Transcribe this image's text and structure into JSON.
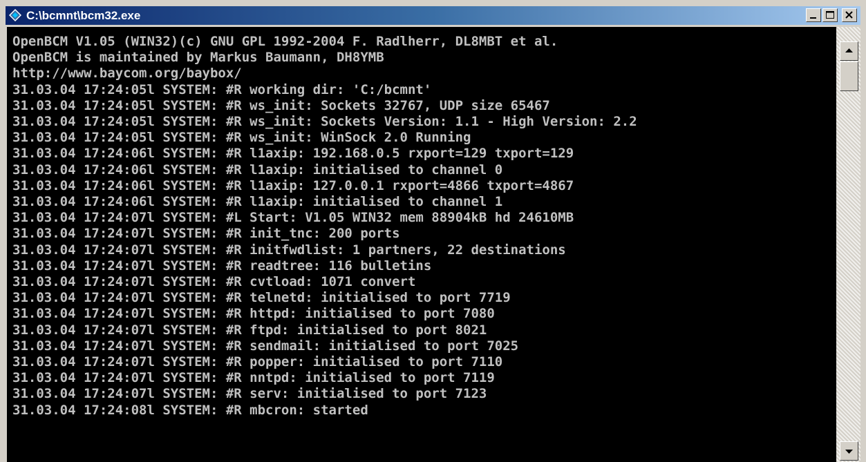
{
  "window": {
    "title": "C:\\bcmnt\\bcm32.exe",
    "titlebar_color": "#0a246a",
    "console_bg": "#000000",
    "console_fg": "#c0c0c0",
    "controls": [
      "minimize-icon",
      "maximize-icon",
      "close-icon"
    ],
    "app_icon": "console-app-icon"
  },
  "console": {
    "lines": [
      "OpenBCM V1.05 (WIN32)(c) GNU GPL 1992-2004 F. Radlherr, DL8MBT et al.",
      "OpenBCM is maintained by Markus Baumann, DH8YMB",
      "http://www.baycom.org/baybox/",
      "31.03.04 17:24:05l SYSTEM: #R working dir: 'C:/bcmnt'",
      "31.03.04 17:24:05l SYSTEM: #R ws_init: Sockets 32767, UDP size 65467",
      "31.03.04 17:24:05l SYSTEM: #R ws_init: Sockets Version: 1.1 - High Version: 2.2",
      "31.03.04 17:24:05l SYSTEM: #R ws_init: WinSock 2.0 Running",
      "31.03.04 17:24:06l SYSTEM: #R l1axip: 192.168.0.5 rxport=129 txport=129",
      "31.03.04 17:24:06l SYSTEM: #R l1axip: initialised to channel 0",
      "31.03.04 17:24:06l SYSTEM: #R l1axip: 127.0.0.1 rxport=4866 txport=4867",
      "31.03.04 17:24:06l SYSTEM: #R l1axip: initialised to channel 1",
      "31.03.04 17:24:07l SYSTEM: #L Start: V1.05 WIN32 mem 88904kB hd 24610MB",
      "31.03.04 17:24:07l SYSTEM: #R init_tnc: 200 ports",
      "31.03.04 17:24:07l SYSTEM: #R initfwdlist: 1 partners, 22 destinations",
      "31.03.04 17:24:07l SYSTEM: #R readtree: 116 bulletins",
      "31.03.04 17:24:07l SYSTEM: #R cvtload: 1071 convert",
      "31.03.04 17:24:07l SYSTEM: #R telnetd: initialised to port 7719",
      "31.03.04 17:24:07l SYSTEM: #R httpd: initialised to port 7080",
      "31.03.04 17:24:07l SYSTEM: #R ftpd: initialised to port 8021",
      "31.03.04 17:24:07l SYSTEM: #R sendmail: initialised to port 7025",
      "31.03.04 17:24:07l SYSTEM: #R popper: initialised to port 7110",
      "31.03.04 17:24:07l SYSTEM: #R nntpd: initialised to port 7119",
      "31.03.04 17:24:07l SYSTEM: #R serv: initialised to port 7123",
      "31.03.04 17:24:08l SYSTEM: #R mbcron: started"
    ]
  },
  "scrollbar": {
    "up_icon": "scroll-up-arrow-icon",
    "down_icon": "scroll-down-arrow-icon"
  }
}
